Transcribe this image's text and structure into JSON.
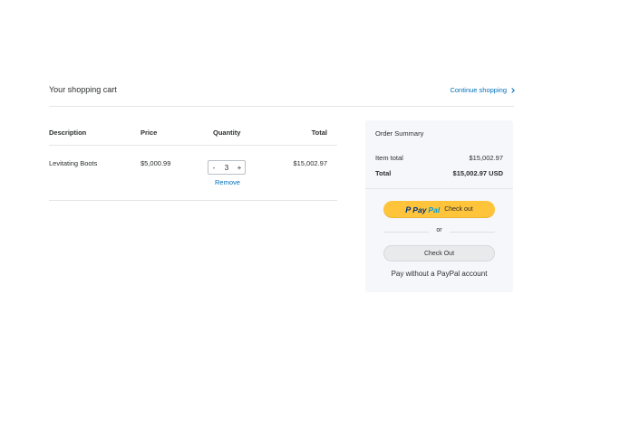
{
  "header": {
    "title": "Your shopping cart",
    "continue_label": "Continue shopping"
  },
  "table": {
    "columns": [
      "Description",
      "Price",
      "Quantity",
      "Total"
    ],
    "items": [
      {
        "description": "Levitating Boots",
        "price": "$5,000.99",
        "quantity": "3",
        "total": "$15,002.97",
        "minus": "-",
        "plus": "+",
        "remove_label": "Remove"
      }
    ]
  },
  "summary": {
    "title": "Order Summary",
    "item_total_label": "Item total",
    "item_total_value": "$15,002.97",
    "total_label": "Total",
    "total_value": "$15,002.97 USD"
  },
  "buttons": {
    "paypal_icon": "P",
    "paypal_pay": "Pay",
    "paypal_pal": "Pal",
    "paypal_checkout": "Check out",
    "or_text": "or",
    "checkout_label": "Check Out",
    "pay_without_label": "Pay without a PayPal account"
  },
  "colors": {
    "link": "#0070ba",
    "paypal_button": "#ffc439",
    "summary_bg": "#f5f7fa"
  },
  "icons": {
    "continue": "chevron-right-icon",
    "paypal": "paypal-logo"
  }
}
